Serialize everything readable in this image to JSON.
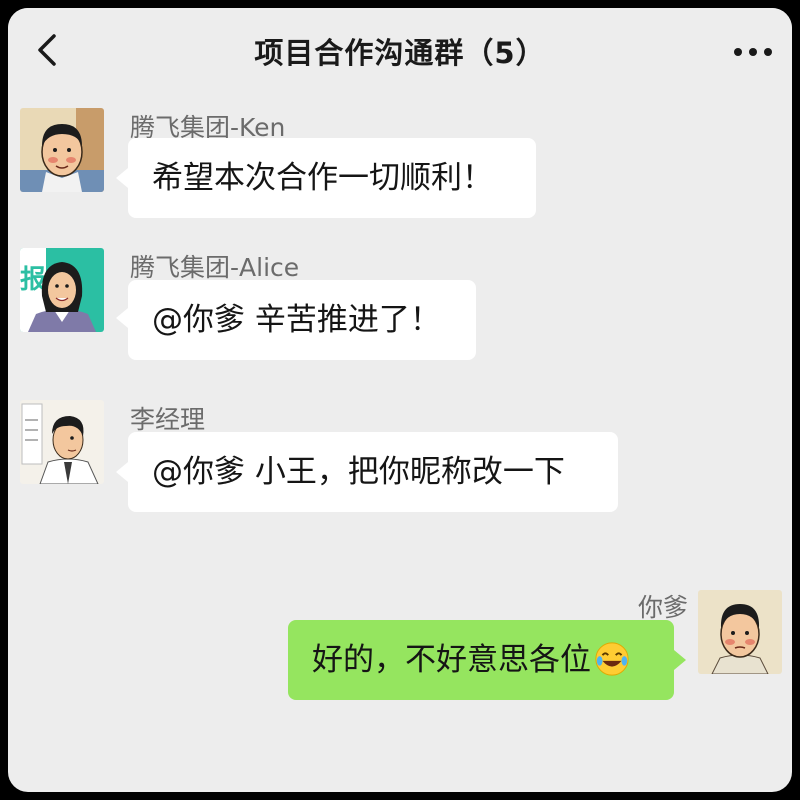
{
  "header": {
    "title": "项目合作沟通群（5）",
    "back_icon": "chevron-left-icon",
    "more_icon": "more-dots-icon"
  },
  "messages": [
    {
      "sender": "腾飞集团-Ken",
      "text": "希望本次合作一切顺利！",
      "direction": "incoming"
    },
    {
      "sender": "腾飞集团-Alice",
      "text": "@你爹 辛苦推进了！",
      "direction": "incoming",
      "avatar_sign_char": "报"
    },
    {
      "sender": "李经理",
      "text": "@你爹 小王，把你昵称改一下",
      "direction": "incoming"
    },
    {
      "sender": "你爹",
      "text": "好的，不好意思各位",
      "direction": "outgoing",
      "emoji": "laughing-crying-emoji"
    }
  ],
  "colors": {
    "background": "#ededed",
    "incoming_bubble": "#ffffff",
    "outgoing_bubble": "#95e55f"
  }
}
